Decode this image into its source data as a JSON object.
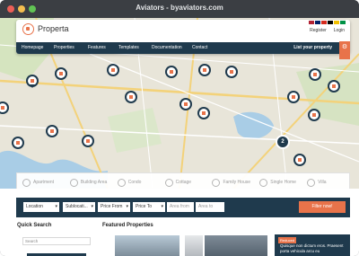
{
  "window": {
    "title": "Aviators - byaviators.com"
  },
  "header": {
    "brand": "Properta",
    "register": "Register",
    "login": "Login",
    "nav": [
      "Homepage",
      "Properties",
      "Features",
      "Templates",
      "Documentation",
      "Contact"
    ],
    "list_property": "List your property"
  },
  "map": {
    "cluster_count": "2"
  },
  "categories": [
    "Apartment",
    "Building Area",
    "Condo",
    "Cottage",
    "Family House",
    "Single Home",
    "Villa"
  ],
  "filter": {
    "location": "Location",
    "sublocation": "Sublocati...",
    "price_from": "Price From",
    "price_to": "Price To",
    "area_from": "Area from",
    "area_to": "Area to",
    "submit": "Filter now!"
  },
  "quick_search": {
    "title": "Quick Search",
    "placeholder": "Search"
  },
  "featured": {
    "title": "Featured Properties"
  },
  "promo": {
    "tag": "Reduced",
    "text": "Quisque non dictum eros. Praesent porta vehicula arcu eu"
  },
  "colors": {
    "accent": "#e8734a",
    "navy": "#1f3a4d"
  }
}
